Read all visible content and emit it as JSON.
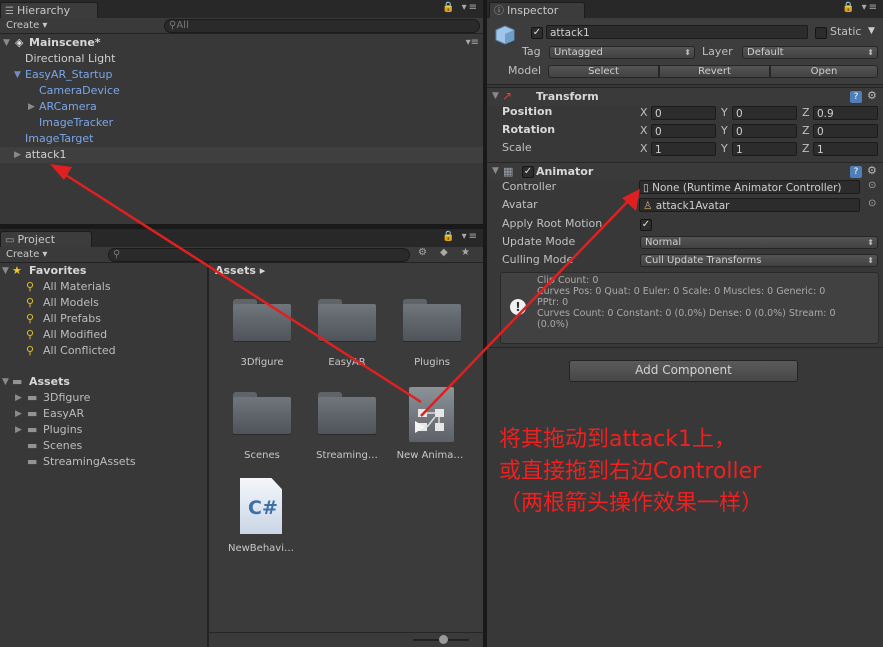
{
  "hierarchy": {
    "tab_label": "Hierarchy",
    "create_label": "Create ▾",
    "search_placeholder": "All",
    "scene": "Mainscene*",
    "items": [
      {
        "label": "Directional Light"
      },
      {
        "label": "EasyAR_Startup"
      },
      {
        "label": "CameraDevice"
      },
      {
        "label": "ARCamera"
      },
      {
        "label": "ImageTracker"
      },
      {
        "label": "ImageTarget"
      },
      {
        "label": "attack1"
      }
    ]
  },
  "project": {
    "tab_label": "Project",
    "create_label": "Create ▾",
    "favorites_label": "Favorites",
    "favorites": [
      "All Materials",
      "All Models",
      "All Prefabs",
      "All Modified",
      "All Conflicted"
    ],
    "assets_label": "Assets",
    "asset_folders": [
      "3Dfigure",
      "EasyAR",
      "Plugins",
      "Scenes",
      "StreamingAssets"
    ],
    "breadcrumb": "Assets ▸",
    "grid_items": [
      {
        "label": "3Dfigure",
        "icon": "folder-icon"
      },
      {
        "label": "EasyAR",
        "icon": "folder-icon"
      },
      {
        "label": "Plugins",
        "icon": "folder-icon"
      },
      {
        "label": "Scenes",
        "icon": "folder-icon"
      },
      {
        "label": "Streaming…",
        "icon": "folder-icon"
      },
      {
        "label": "New Anima…",
        "icon": "animator-controller-icon"
      },
      {
        "label": "NewBehavi…",
        "icon": "csharp-script-icon"
      }
    ]
  },
  "inspector": {
    "tab_label": "Inspector",
    "object_name": "attack1",
    "static_label": "Static",
    "tag_label": "Tag",
    "tag_value": "Untagged",
    "layer_label": "Layer",
    "layer_value": "Default",
    "model_label": "Model",
    "model_buttons": [
      "Select",
      "Revert",
      "Open"
    ],
    "transform": {
      "title": "Transform",
      "rows": [
        {
          "label": "Position",
          "x": "0",
          "y": "0",
          "z": "0.9"
        },
        {
          "label": "Rotation",
          "x": "0",
          "y": "0",
          "z": "0"
        },
        {
          "label": "Scale",
          "x": "1",
          "y": "1",
          "z": "1"
        }
      ],
      "axes": [
        "X",
        "Y",
        "Z"
      ]
    },
    "animator": {
      "title": "Animator",
      "controller_label": "Controller",
      "controller_value": "None (Runtime Animator Controller)",
      "avatar_label": "Avatar",
      "avatar_value": "attack1Avatar",
      "apply_root_motion_label": "Apply Root Motion",
      "update_mode_label": "Update Mode",
      "update_mode_value": "Normal",
      "culling_mode_label": "Culling Mode",
      "culling_mode_value": "Cull Update Transforms",
      "info_lines": [
        "Clip Count: 0",
        "Curves Pos: 0 Quat: 0 Euler: 0 Scale: 0 Muscles: 0 Generic: 0",
        "PPtr: 0",
        "Curves Count: 0 Constant: 0 (0.0%) Dense: 0 (0.0%) Stream: 0",
        "(0.0%)"
      ]
    },
    "add_component_label": "Add Component"
  },
  "annotation": {
    "lines": [
      "将其拖动到attack1上，",
      "或直接拖到右边Controller",
      "（两根箭头操作效果一样）"
    ],
    "color": "#ef2020"
  }
}
